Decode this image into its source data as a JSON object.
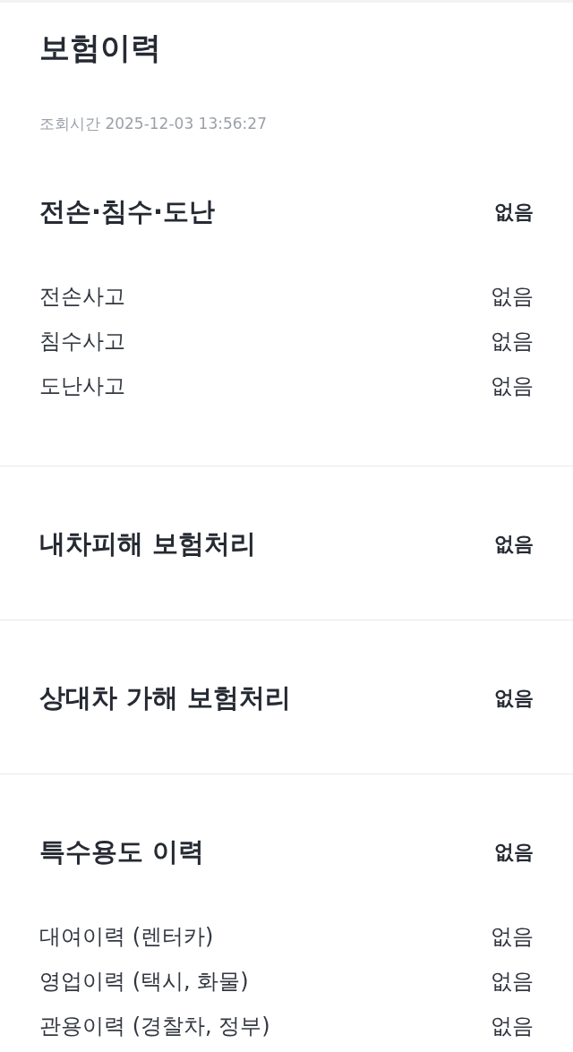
{
  "title": "보험이력",
  "query_time": "조회시간 2025-12-03 13:56:27",
  "sections": [
    {
      "heading": "전손·침수·도난",
      "status": "없음",
      "rows": [
        {
          "label": "전손사고",
          "value": "없음"
        },
        {
          "label": "침수사고",
          "value": "없음"
        },
        {
          "label": "도난사고",
          "value": "없음"
        }
      ]
    },
    {
      "heading": "내차피해 보험처리",
      "status": "없음"
    },
    {
      "heading": "상대차 가해 보험처리",
      "status": "없음"
    },
    {
      "heading": "특수용도 이력",
      "status": "없음",
      "rows": [
        {
          "label": "대여이력 (렌터카)",
          "value": "없음"
        },
        {
          "label": "영업이력 (택시, 화물)",
          "value": "없음"
        },
        {
          "label": "관용이력 (경찰차, 정부)",
          "value": "없음"
        }
      ]
    }
  ]
}
